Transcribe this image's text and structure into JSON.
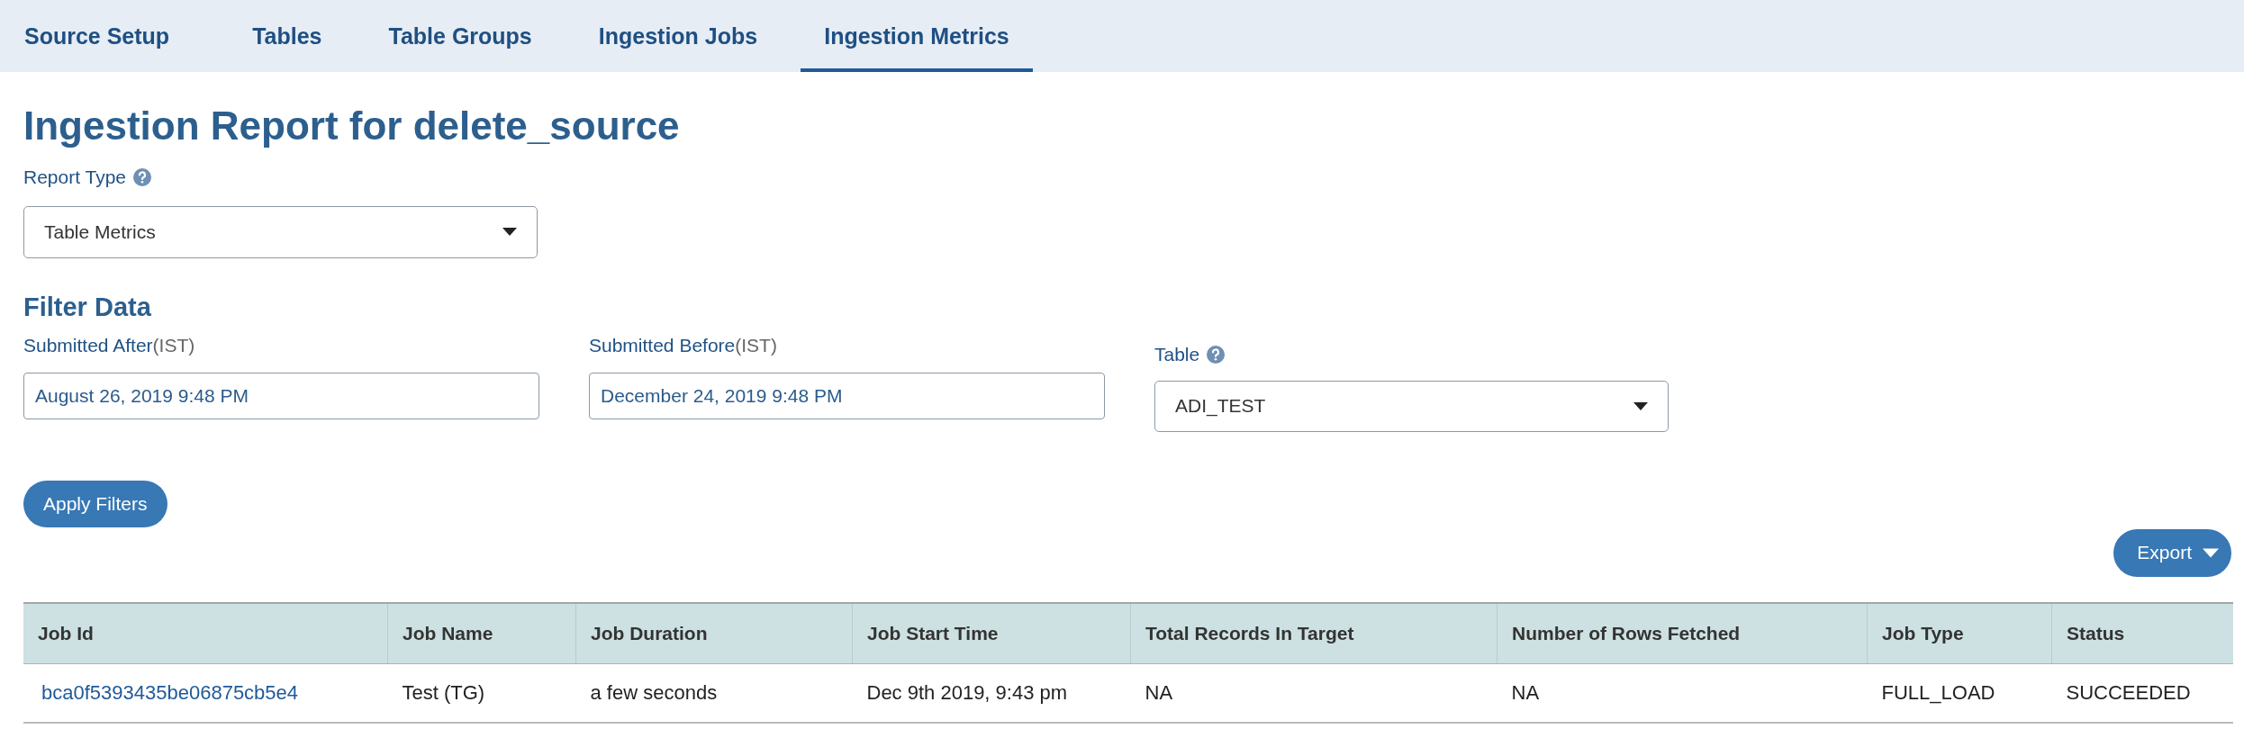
{
  "tabs": [
    {
      "label": "Source Setup",
      "selected": false
    },
    {
      "label": "Tables",
      "selected": false
    },
    {
      "label": "Table Groups",
      "selected": false
    },
    {
      "label": "Ingestion Jobs",
      "selected": false
    },
    {
      "label": "Ingestion Metrics",
      "selected": true
    }
  ],
  "title": "Ingestion Report for delete_source",
  "report_type": {
    "label": "Report Type",
    "value": "Table Metrics"
  },
  "filter": {
    "heading": "Filter Data",
    "fields": [
      {
        "kind": "input",
        "label": "Submitted After",
        "suffix": "(IST)",
        "value": "August 26, 2019 9:48 PM"
      },
      {
        "kind": "input",
        "label": "Submitted Before",
        "suffix": "(IST)",
        "value": "December 24, 2019 9:48 PM"
      },
      {
        "kind": "select",
        "label": "Table",
        "value": "ADI_TEST"
      }
    ],
    "apply_button": "Apply Filters"
  },
  "export_button": "Export",
  "table": {
    "columns": [
      "Job Id",
      "Job Name",
      "Job Duration",
      "Job Start Time",
      "Total Records In Target",
      "Number of Rows Fetched",
      "Job Type",
      "Status"
    ],
    "rows": [
      [
        "bca0f5393435be06875cb5e4",
        "Test (TG)",
        "a few seconds",
        "Dec 9th 2019, 9:43 pm",
        "NA",
        "NA",
        "FULL_LOAD",
        "SUCCEEDED"
      ]
    ]
  }
}
